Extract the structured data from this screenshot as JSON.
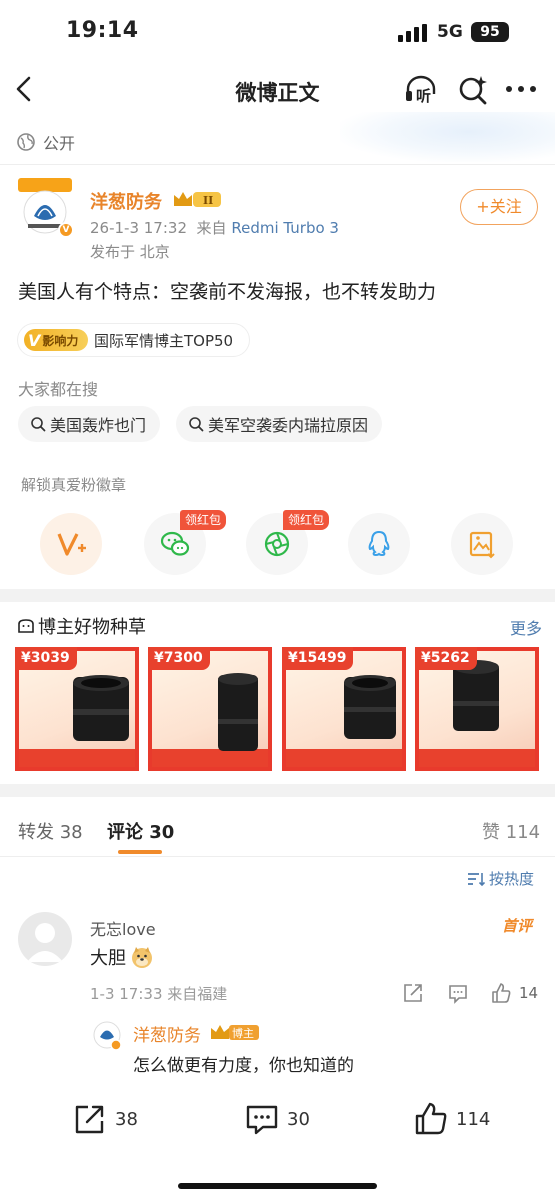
{
  "status_bar": {
    "time": "19:14",
    "network": "5G",
    "battery": "95"
  },
  "nav": {
    "title": "微博正文",
    "listen_label": "听"
  },
  "post": {
    "visibility": "公开",
    "author": {
      "name": "洋葱防务",
      "level_badge": "II"
    },
    "timestamp": "26-1-3 17:32",
    "source_prefix": "来自",
    "device": "Redmi Turbo 3",
    "location": "发布于 北京",
    "follow_label": "+关注",
    "text": "美国人有个特点：空袭前不发海报，也不转发助力",
    "influence": {
      "icon_text": "影响力",
      "label": "国际军情博主TOP50"
    },
    "hot_search_title": "大家都在搜",
    "hot_searches": [
      "美国轰炸也门",
      "美军空袭委内瑞拉原因"
    ],
    "unlock_title": "解锁真爱粉徽章",
    "share_targets": [
      {
        "icon": "v-plus-icon",
        "tag": ""
      },
      {
        "icon": "wechat-icon",
        "tag": "领红包"
      },
      {
        "icon": "moments-icon",
        "tag": "领红包"
      },
      {
        "icon": "qq-icon",
        "tag": ""
      },
      {
        "icon": "save-image-icon",
        "tag": ""
      }
    ]
  },
  "goods": {
    "title": "博主好物种草",
    "more": "更多",
    "items": [
      {
        "price": "¥3039"
      },
      {
        "price": "¥7300"
      },
      {
        "price": "¥15499"
      },
      {
        "price": "¥5262"
      }
    ]
  },
  "tabs": {
    "repost_label": "转发",
    "repost_count": "38",
    "comment_label": "评论",
    "comment_count": "30",
    "like_label": "赞",
    "like_count": "114"
  },
  "sort_label": "按热度",
  "comment": {
    "user": "无忘love",
    "badge": "首评",
    "text": "大胆",
    "time": "1-3 17:33",
    "from": "来自福建",
    "like_count": "14",
    "reply": {
      "user": "洋葱防务",
      "badge": "博主",
      "text": "怎么做更有力度，你也知道的"
    }
  },
  "bottom_bar": {
    "repost": "38",
    "comment": "30",
    "like": "114"
  },
  "colors": {
    "accent": "#f08a2b",
    "link": "#507daf",
    "red": "#e8412d"
  }
}
